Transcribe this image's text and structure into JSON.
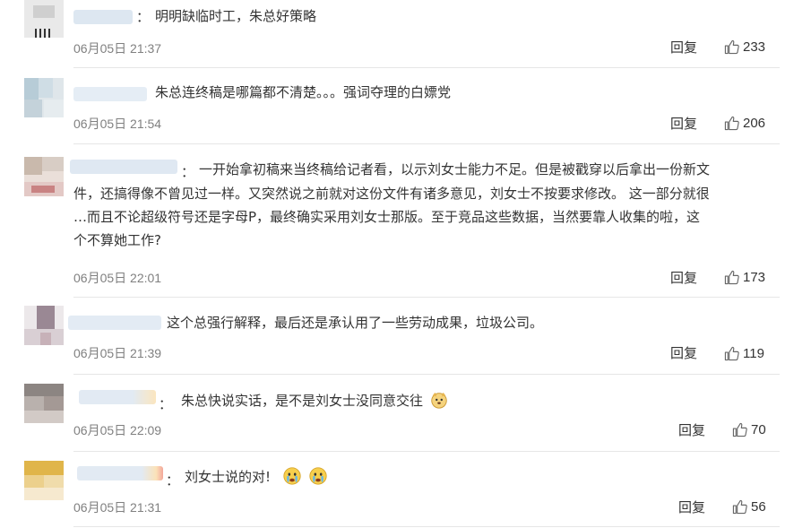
{
  "comments": [
    {
      "text": [
        "明明缺临时工，朱总好策略"
      ],
      "time": "06月05日 21:37",
      "reply": "回复",
      "likes": "233"
    },
    {
      "text": [
        "朱总连终稿是哪篇都不清楚。。。强词夺理的白嫖党"
      ],
      "time": "06月05日 21:54",
      "reply": "回复",
      "likes": "206"
    },
    {
      "text": [
        "一开始拿初稿来当终稿给记者看，以示刘女士能力不足。但是被戳穿以后拿出一份新文",
        "件，还搞得像不曾见过一样。又突然说之前就对这份文件有诸多意见，刘女士不按要求修改。 这一部分就很",
        "…而且不论超级符号还是字母P，最终确实采用刘女士那版。至于竞品这些数据，当然要靠人收集的啦，这",
        "个不算她工作?"
      ],
      "time": "06月05日 22:01",
      "reply": "回复",
      "likes": "173"
    },
    {
      "text": [
        "这个总强行解释，最后还是承认用了一些劳动成果，垃圾公司。"
      ],
      "time": "06月05日 21:39",
      "reply": "回复",
      "likes": "119"
    },
    {
      "text": [
        "朱总快说实话，是不是刘女士没同意交往"
      ],
      "time": "06月05日 22:09",
      "reply": "回复",
      "likes": "70"
    },
    {
      "text": [
        "刘女士说的对!"
      ],
      "time": "06月05日 21:31",
      "reply": "回复",
      "likes": "56"
    }
  ],
  "colon": "："
}
